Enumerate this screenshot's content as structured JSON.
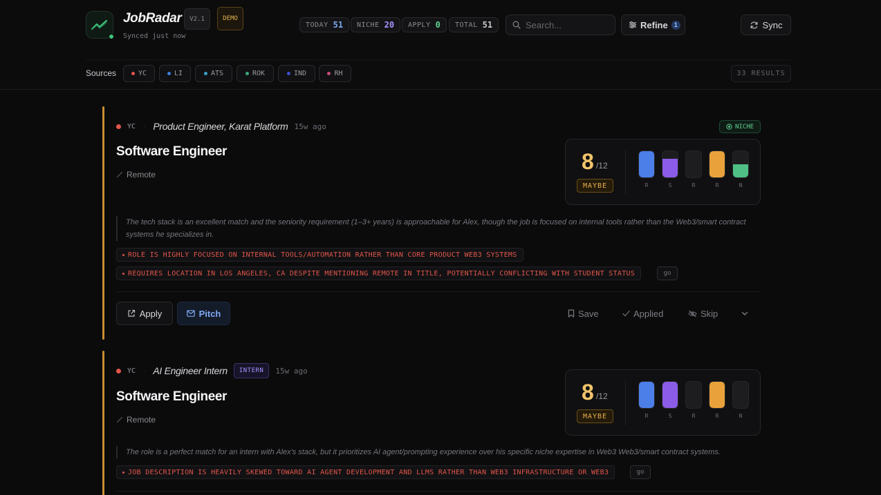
{
  "app": {
    "name": "JobRadar",
    "version": "V2.1",
    "mode": "DEMO",
    "synced": "Synced just now"
  },
  "stats": [
    {
      "label": "TODAY",
      "value": "51",
      "color": "#7ea9f2"
    },
    {
      "label": "NICHE",
      "value": "20",
      "color": "#a594ff"
    },
    {
      "label": "APPLY",
      "value": "0",
      "color": "#5fd392"
    },
    {
      "label": "TOTAL",
      "value": "51",
      "color": "#c8c8cd"
    }
  ],
  "search": {
    "placeholder": "Search..."
  },
  "refine": {
    "label": "Refine",
    "count": "1"
  },
  "sync": {
    "label": "Sync"
  },
  "sources": {
    "label": "Sources",
    "chips": [
      {
        "code": "YC",
        "color": "#e2554a"
      },
      {
        "code": "LI",
        "color": "#3e7be0"
      },
      {
        "code": "ATS",
        "color": "#3aa0c8"
      },
      {
        "code": "ROK",
        "color": "#38a67a"
      },
      {
        "code": "IND",
        "color": "#3f4fd0"
      },
      {
        "code": "RH",
        "color": "#c94a78"
      }
    ],
    "results": "33 RESULTS"
  },
  "jobs": [
    {
      "source": "YC",
      "company": "Product Engineer, Karat Platform",
      "ago": "15w ago",
      "badge": "",
      "niche_label": "NICHE",
      "title": "Software Engineer",
      "location": "Remote",
      "score": "8",
      "max": "/12",
      "verdict": "MAYBE",
      "bars": [
        {
          "letter": "R",
          "fill": 1.0,
          "color": "#4c7fe8"
        },
        {
          "letter": "S",
          "fill": 0.7,
          "color": "#8b5ce8"
        },
        {
          "letter": "R",
          "fill": 0.0,
          "color": "#4c7fe8"
        },
        {
          "letter": "R",
          "fill": 1.0,
          "color": "#e9a23b"
        },
        {
          "letter": "N",
          "fill": 0.5,
          "color": "#4fbf86"
        }
      ],
      "reason": "The tech stack is an excellent match and the seniority requirement (1–3+ years) is approachable for Alex, though the job is focused on internal tools rather than the Web3/smart contract systems he specializes in.",
      "flags": [
        "ROLE IS HIGHLY FOCUSED ON INTERNAL TOOLS/AUTOMATION RATHER THAN CORE PRODUCT WEB3 SYSTEMS",
        "REQUIRES LOCATION IN LOS ANGELES, CA DESPITE MENTIONING REMOTE IN TITLE, POTENTIALLY CONFLICTING WITH STUDENT STATUS"
      ],
      "go": "go"
    },
    {
      "source": "YC",
      "company": "AI Engineer Intern",
      "ago": "15w ago",
      "badge": "INTERN",
      "title": "Software Engineer",
      "location": "Remote",
      "score": "8",
      "max": "/12",
      "verdict": "MAYBE",
      "bars": [
        {
          "letter": "R",
          "fill": 1.0,
          "color": "#4c7fe8"
        },
        {
          "letter": "S",
          "fill": 1.0,
          "color": "#8b5ce8"
        },
        {
          "letter": "R",
          "fill": 0.0,
          "color": "#4c7fe8"
        },
        {
          "letter": "R",
          "fill": 1.0,
          "color": "#e9a23b"
        },
        {
          "letter": "N",
          "fill": 0.0,
          "color": "#4fbf86"
        }
      ],
      "reason": "The role is a perfect match for an intern with Alex's stack, but it prioritizes AI agent/prompting experience over his specific niche expertise in Web3 Web3/smart contract systems.",
      "flags": [
        "JOB DESCRIPTION IS HEAVILY SKEWED TOWARD AI AGENT DEVELOPMENT AND LLMS RATHER THAN WEB3 INFRASTRUCTURE OR WEB3"
      ],
      "go": "go"
    }
  ],
  "actions": {
    "apply": "Apply",
    "pitch": "Pitch",
    "save": "Save",
    "applied": "Applied",
    "skip": "Skip"
  }
}
